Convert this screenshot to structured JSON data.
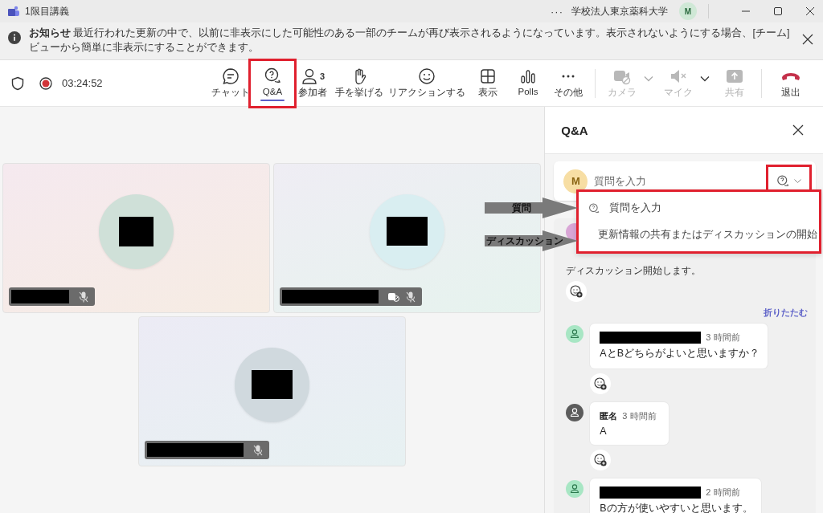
{
  "window": {
    "title": "1限目講義",
    "more": "···",
    "organization": "学校法人東京薬科大学",
    "avatar": "M"
  },
  "notice": {
    "text": "**お知らせ** 最近行われた更新の中で、以前に非表示にした可能性のある一部のチームが再び表示されるようになっています。表示されないようにする場合、[チーム] ビューから簡単に非表示にすることができます。"
  },
  "meeting": {
    "recording": true,
    "elapsed": "03:24:52"
  },
  "toolbar": [
    {
      "kind": "chat",
      "label": "チャット",
      "selected": false,
      "disabled": false
    },
    {
      "kind": "qa",
      "label": "Q&A",
      "selected": true,
      "disabled": false,
      "highlighted": true
    },
    {
      "kind": "people",
      "label": "参加者",
      "badge": "3",
      "selected": false,
      "disabled": false
    },
    {
      "kind": "hand",
      "label": "手を挙げる",
      "selected": false,
      "disabled": false
    },
    {
      "kind": "react",
      "label": "リアクションする",
      "selected": false,
      "disabled": false
    },
    {
      "kind": "view",
      "label": "表示",
      "selected": false,
      "disabled": false
    },
    {
      "kind": "polls",
      "label": "Polls",
      "selected": false,
      "disabled": false
    },
    {
      "kind": "more",
      "label": "その他",
      "selected": false,
      "disabled": false
    },
    {
      "kind": "camera",
      "label": "カメラ",
      "selected": false,
      "disabled": true,
      "split": true
    },
    {
      "kind": "mic",
      "label": "マイク",
      "selected": false,
      "disabled": true,
      "split": true
    },
    {
      "kind": "share",
      "label": "共有",
      "selected": false,
      "disabled": true
    },
    {
      "kind": "leave",
      "label": "退出",
      "selected": false,
      "disabled": false
    }
  ],
  "tiles": [
    {
      "color": "#cfe0d8",
      "muted": true,
      "camera_off": false
    },
    {
      "color": "#d9eef1",
      "muted": true,
      "camera_off": true
    },
    {
      "color": "#d0d9de",
      "muted": true,
      "camera_off": false
    }
  ],
  "qa_panel": {
    "title": "Q&A",
    "composer": {
      "avatar": "M",
      "placeholder": "質問を入力"
    },
    "menu": [
      {
        "kind": "question",
        "label": "質問を入力"
      },
      {
        "kind": "discussion",
        "label": "更新情報の共有またはディスカッションの開始"
      }
    ],
    "post": {
      "color": "#d9a6d6",
      "text": "ディスカッション開始します。"
    },
    "collapse": "折りたたむ",
    "replies": [
      {
        "color": "#a8e6c4",
        "time": "3 時間前",
        "text": "AとBどちらがよいと思いますか？"
      },
      {
        "color": "#5c5c5c",
        "author": "匿名",
        "time": "3 時間前",
        "text": "A"
      },
      {
        "color": "#a8e6c4",
        "time": "2 時間前",
        "text": "Bの方が使いやすいと思います。"
      }
    ]
  },
  "annotations": [
    {
      "label": "質問"
    },
    {
      "label": "ディスカッション"
    }
  ]
}
